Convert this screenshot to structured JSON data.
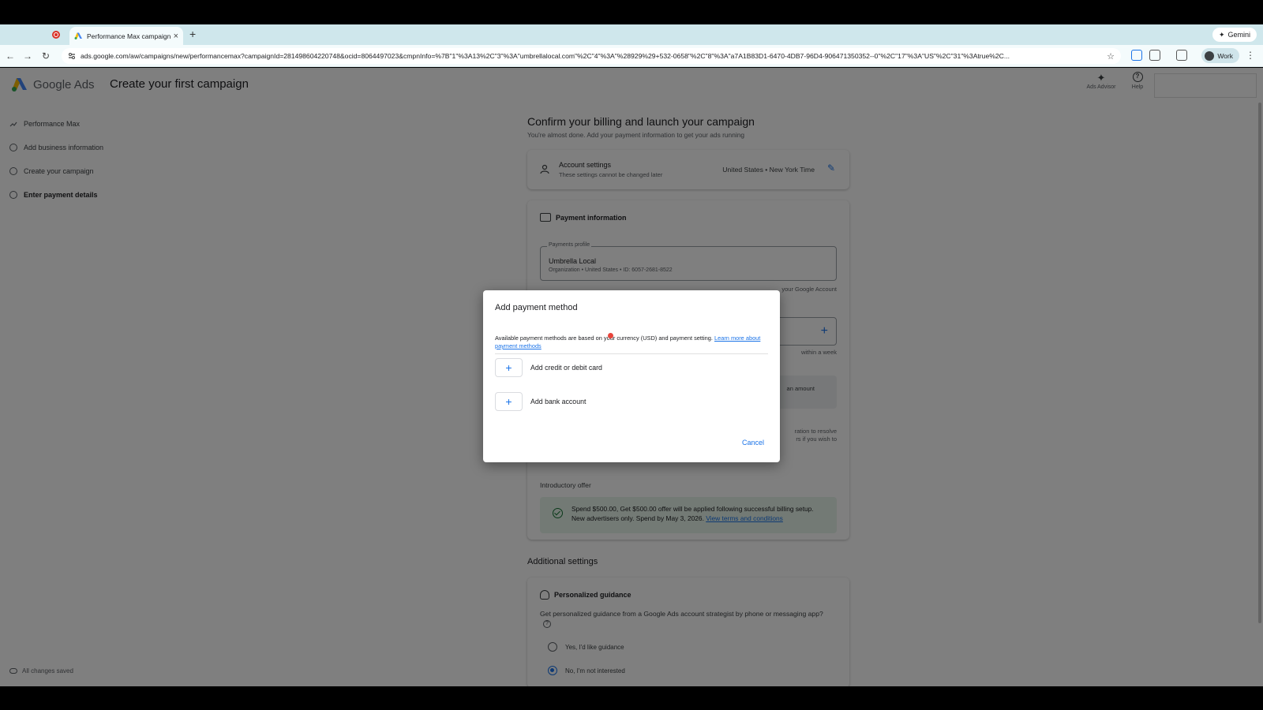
{
  "browser": {
    "tab_title": "Performance Max campaign -",
    "url": "ads.google.com/aw/campaigns/new/performancemax?campaignId=281498604220748&ocid=8064497023&cmpnInfo=%7B\"1\"%3A13%2C\"3\"%3A\"umbrellalocal.com\"%2C\"4\"%3A\"%28929%29+532-0658\"%2C\"8\"%3A\"a7A1B83D1-6470-4DB7-96D4-906471350352--0\"%2C\"17\"%3A\"US\"%2C\"31\"%3Atrue%2C...",
    "gemini_label": "Gemini",
    "profile_label": "Work"
  },
  "app": {
    "brand": "Google Ads",
    "page_title": "Create your first campaign",
    "advisor_label": "Ads Advisor",
    "help_label": "Help"
  },
  "sidenav": {
    "items": [
      {
        "label": "Performance Max"
      },
      {
        "label": "Add business information"
      },
      {
        "label": "Create your campaign"
      },
      {
        "label": "Enter payment details"
      }
    ],
    "saved_label": "All changes saved"
  },
  "main": {
    "heading": "Confirm your billing and launch your campaign",
    "subheading": "You're almost done. Add your payment information to get your ads running",
    "account_settings": {
      "title": "Account settings",
      "subtitle": "These settings cannot be changed later",
      "value": "United States • New York Time"
    },
    "payment_info": {
      "title": "Payment information",
      "profile_label": "Payments profile",
      "profile_name": "Umbrella Local",
      "profile_detail": "Organization • United States • ID: 6057-2681-8522",
      "account_note_tail": "your Google Account",
      "week_tail": "within a week",
      "amount_tail": "an amount",
      "resolve_tail_1": "ration to resolve",
      "resolve_tail_2": "rs if you wish to"
    },
    "intro_offer": {
      "label": "Introductory offer",
      "text": "Spend $500.00, Get $500.00 offer will be applied following successful billing setup. New advertisers only. Spend by May 3, 2026.",
      "link": "View terms and conditions"
    },
    "additional_settings": "Additional settings",
    "guidance": {
      "title": "Personalized guidance",
      "desc": "Get personalized guidance from a Google Ads account strategist by phone or messaging app?",
      "options": [
        {
          "label": "Yes, I'd like guidance",
          "selected": false
        },
        {
          "label": "No, I'm not interested",
          "selected": true
        }
      ]
    }
  },
  "dialog": {
    "title": "Add payment method",
    "info": "Available payment methods are based on your currency (USD) and payment setting.",
    "info_link": "Learn more about payment methods",
    "options": [
      {
        "label": "Add credit or debit card"
      },
      {
        "label": "Add bank account"
      }
    ],
    "cancel": "Cancel"
  }
}
